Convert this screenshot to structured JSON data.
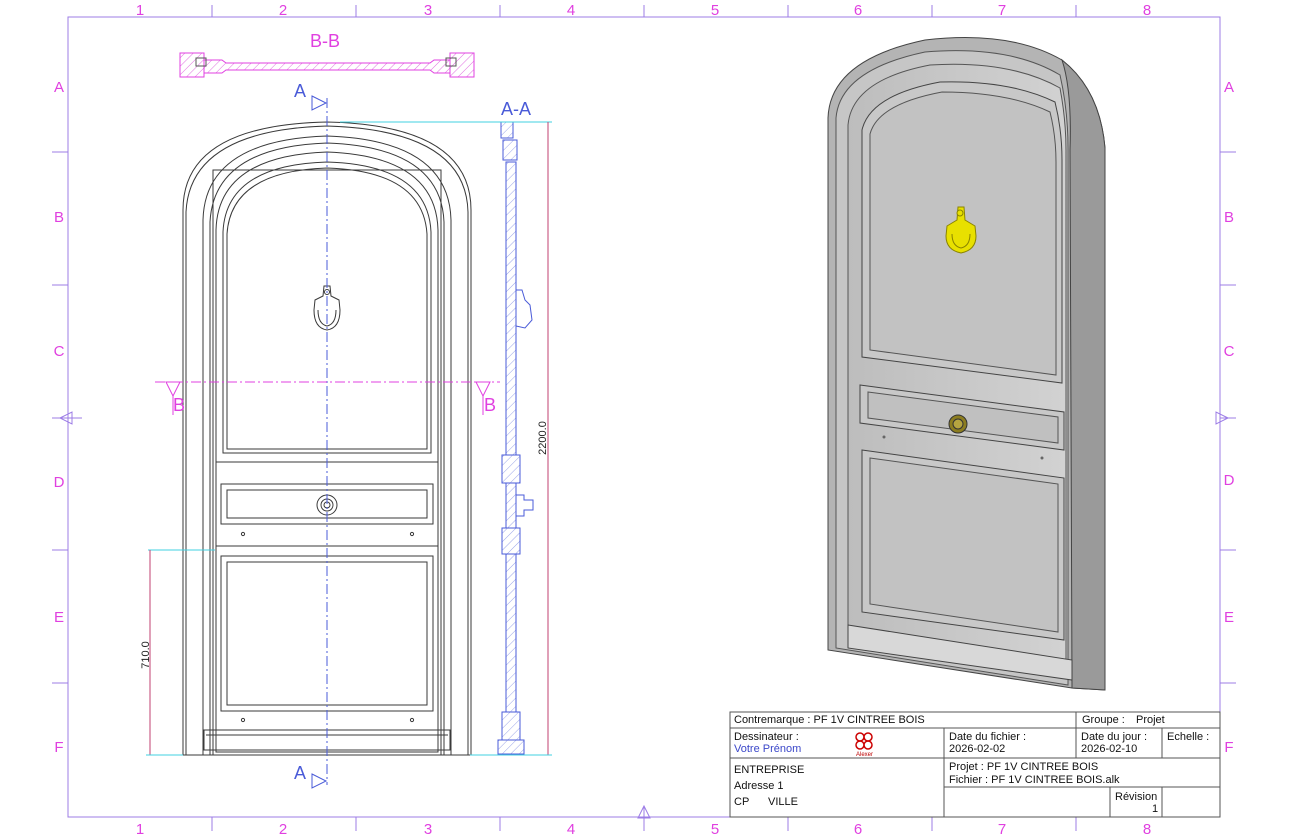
{
  "frame": {
    "columns": [
      "1",
      "2",
      "3",
      "4",
      "5",
      "6",
      "7",
      "8"
    ],
    "rows": [
      "A",
      "B",
      "C",
      "D",
      "E",
      "F"
    ]
  },
  "views": {
    "section_bb": "B-B",
    "section_aa": "A-A",
    "arrow_a": "A",
    "arrow_b": "B"
  },
  "dimensions": {
    "height_total": "2200.0",
    "height_handle": "710.0"
  },
  "title_block": {
    "contremarque": "Contremarque : PF 1V CINTREE BOIS",
    "groupe_label": "Groupe :",
    "groupe_value": "Projet",
    "dessinateur_label": "Dessinateur :",
    "dessinateur_value": "Votre Prénom",
    "logo_text": "Alexer",
    "date_fichier_label": "Date du fichier :",
    "date_fichier_value": "2026-02-02",
    "date_jour_label": "Date du jour :",
    "date_jour_value": "2026-02-10",
    "echelle_label": "Echelle :",
    "entreprise": "ENTREPRISE",
    "adresse": "Adresse 1",
    "cp": "CP",
    "ville": "VILLE",
    "projet": "Projet :  PF 1V CINTREE BOIS",
    "fichier": "Fichier : PF 1V CINTREE BOIS.alk",
    "revision_label": "Révision",
    "revision_value": "1"
  },
  "colors": {
    "frame": "#e040e0",
    "drawing": "#333333",
    "section": "#4a5bd8",
    "hatch": "#e070e0",
    "dimension": "#c04070",
    "cyan": "#40d0e0",
    "knocker_3d": "#e8e000"
  }
}
